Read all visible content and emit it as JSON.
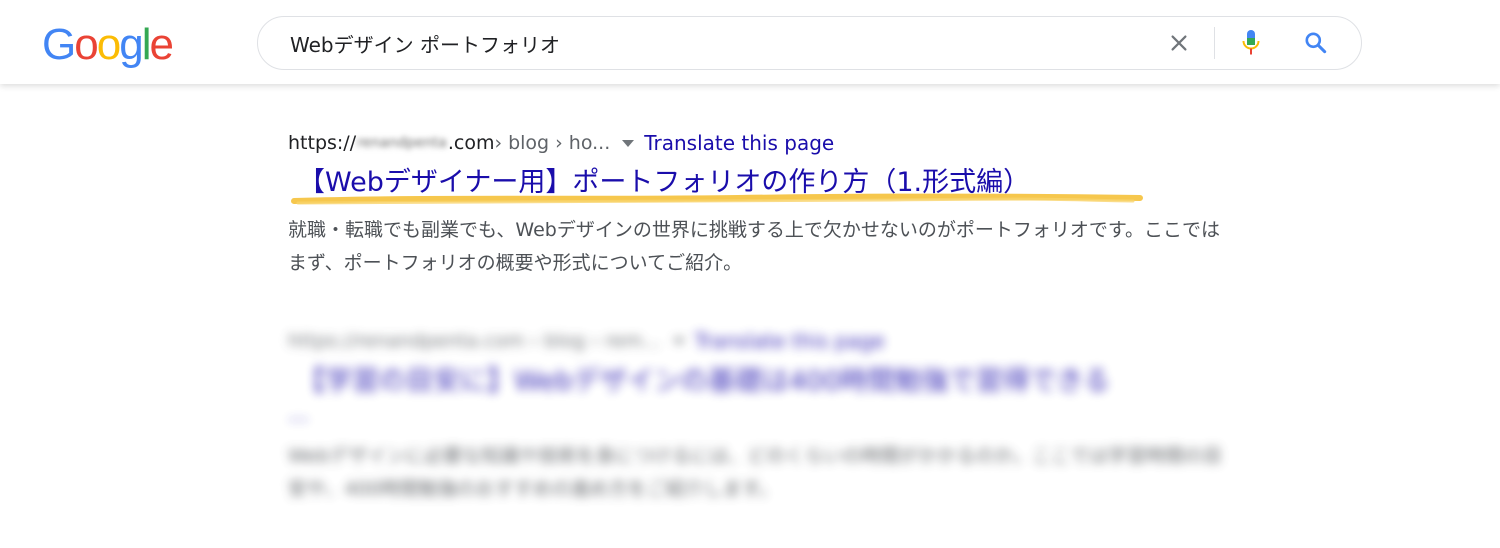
{
  "header": {
    "logo": {
      "letters": [
        "G",
        "o",
        "o",
        "g",
        "l",
        "e"
      ],
      "colors": [
        "#4285f4",
        "#ea4335",
        "#fbbc05",
        "#4285f4",
        "#34a853",
        "#ea4335"
      ]
    },
    "search": {
      "value": "Webデザイン ポートフォリオ",
      "clear_icon": "close-icon",
      "mic_icon": "microphone-icon",
      "search_icon": "search-icon"
    }
  },
  "results": [
    {
      "url_prefix": "https://",
      "url_blurred": "renandpenta",
      "url_suffix": ".com",
      "breadcrumb": " › blog › ho...",
      "translate_label": "Translate this page",
      "title": "【Webデザイナー用】ポートフォリオの作り方（1.形式編）",
      "snippet": "就職・転職でも副業でも、Webデザインの世界に挑戦する上で欠かせないのがポートフォリオです。ここではまず、ポートフォリオの概要や形式についてご紹介。",
      "highlight_color": "#f6c443"
    },
    {
      "url": "https://renandpenta.com › blog › rem... ",
      "translate_label": "Translate this page",
      "title": "【学習の目安に】Webデザインの基礎は400時間勉強で習得できる",
      "ellipsis": "...",
      "snippet": "Webデザインに必要な知識や技術を身につけるには、どのくらいの時間がかかるのか。ここでは学習時間の目安や、400時間勉強のおすすめの進め方をご紹介します。"
    }
  ],
  "colors": {
    "link": "#1a0dab",
    "text": "#202124",
    "snippet": "#4d5156",
    "cite": "#5f6368"
  }
}
